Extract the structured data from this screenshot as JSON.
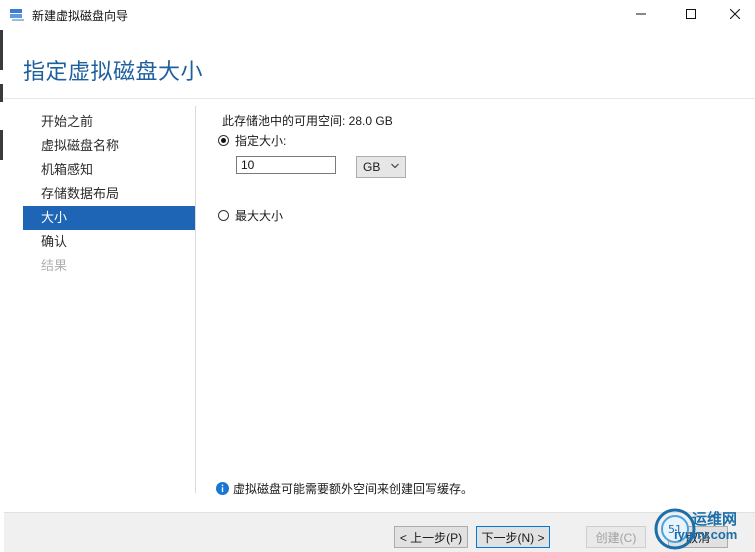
{
  "window": {
    "title": "新建虚拟磁盘向导"
  },
  "header": {
    "page_title": "指定虚拟磁盘大小"
  },
  "nav": {
    "items": [
      {
        "label": "开始之前",
        "state": "normal"
      },
      {
        "label": "虚拟磁盘名称",
        "state": "normal"
      },
      {
        "label": "机箱感知",
        "state": "normal"
      },
      {
        "label": "存储数据布局",
        "state": "normal"
      },
      {
        "label": "大小",
        "state": "active"
      },
      {
        "label": "确认",
        "state": "normal"
      },
      {
        "label": "结果",
        "state": "disabled"
      }
    ]
  },
  "main": {
    "available_space": "此存储池中的可用空间: 28.0 GB",
    "specify_size_label": "指定大小:",
    "size_value": "10",
    "unit_selected": "GB",
    "max_size_label": "最大大小",
    "info_text": "虚拟磁盘可能需要额外空间来创建回写缓存。"
  },
  "footer": {
    "prev_label": "< 上一步(P)",
    "next_label": "下一步(N) >",
    "create_label": "创建(C)",
    "cancel_label": "取消"
  },
  "watermark": {
    "line1": "运维网",
    "line2": "iyunv.com",
    "badge": "51"
  },
  "colors": {
    "accent": "#1f65b5",
    "title_blue": "#1f5f9e",
    "info_blue": "#1976d2"
  }
}
